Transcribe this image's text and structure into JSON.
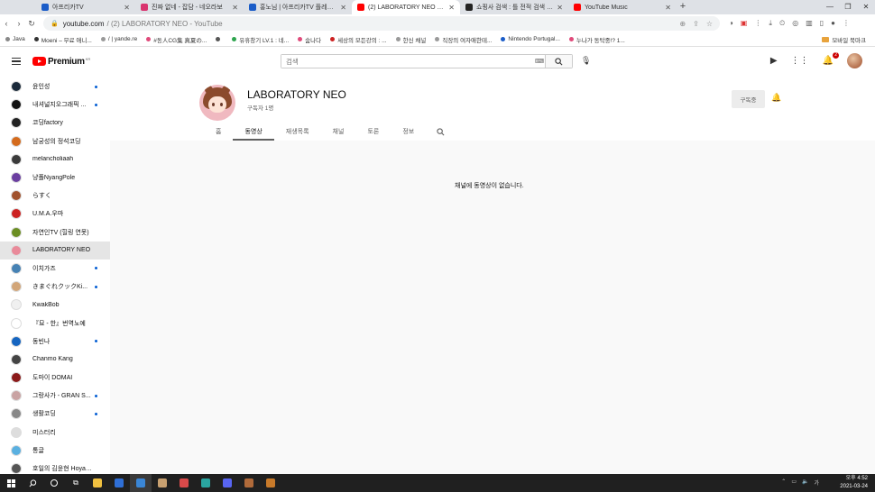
{
  "browser": {
    "tabs": [
      {
        "title": "아프리카TV",
        "color": "#1a5cc8",
        "active": false,
        "width": 110
      },
      {
        "title": "진짜 없네 - 잡담 - 네오라보",
        "color": "#d9346f",
        "active": false,
        "width": 120
      },
      {
        "title": "홍노님 | 아프리카TV 플레이어",
        "color": "#1a5cc8",
        "active": false,
        "width": 120
      },
      {
        "title": "(2) LABORATORY NEO - YouTu",
        "color": "#ff0000",
        "active": true,
        "width": 120
      },
      {
        "title": "쇼핑사 검색 : 틀 전적 검색 포!",
        "color": "#222222",
        "active": false,
        "width": 120
      },
      {
        "title": "YouTube Music",
        "color": "#ff0000",
        "active": false,
        "width": 120
      }
    ],
    "new_tab": "+",
    "window_controls": [
      "—",
      "❐",
      "✕"
    ],
    "url_host": "youtube.com",
    "url_rest": "/ (2) LABORATORY NEO - YouTube",
    "bookmarks": [
      {
        "label": "Java",
        "color": "#888888"
      },
      {
        "label": "Moeni – 무료 애니...",
        "color": "#333333"
      },
      {
        "label": "/ | yande.re",
        "color": "#999999"
      },
      {
        "label": "#동人CG集 真夏の...",
        "color": "#e04a7a"
      },
      {
        "label": "",
        "color": "#555555"
      },
      {
        "label": "유휴창기 LV.1 : 네...",
        "color": "#2da44e"
      },
      {
        "label": "숨나다",
        "color": "#e04a7a"
      },
      {
        "label": "세상의 모든강의 : ...",
        "color": "#cc2222"
      },
      {
        "label": "한신 채널",
        "color": "#999999"
      },
      {
        "label": "직장의 여자애한테...",
        "color": "#999999"
      },
      {
        "label": "Nintendo Portugal...",
        "color": "#1a5cc8"
      },
      {
        "label": "누나가 동탁중!? 1...",
        "color": "#e04a7a"
      }
    ],
    "other_bookmarks": "모바일 북마크"
  },
  "youtube": {
    "logo_text": "Premium",
    "logo_suffix": "KR",
    "search_placeholder": "검색",
    "notifications_count": "2",
    "subscriptions": [
      {
        "name": "윤인성",
        "color": "#1b2a3a",
        "live": true
      },
      {
        "name": "내셔널지오그래픽 ...",
        "color": "#111111",
        "live": true
      },
      {
        "name": "코딩factory",
        "color": "#222222",
        "live": false
      },
      {
        "name": "남궁성의 정석코딩",
        "color": "#d46b1d",
        "live": false
      },
      {
        "name": "melancholiaah",
        "color": "#3b3b3b",
        "live": false
      },
      {
        "name": "냥폴NyangPole",
        "color": "#6b3fa0",
        "live": false
      },
      {
        "name": "らすく",
        "color": "#a0522d",
        "live": false
      },
      {
        "name": "U.M.A.우마",
        "color": "#cc2222",
        "live": false
      },
      {
        "name": "자연인TV (힐링 연못)",
        "color": "#6b8e23",
        "live": false
      },
      {
        "name": "LABORATORY NEO",
        "color": "#e98a9a",
        "live": false,
        "active": true
      },
      {
        "name": "이치가즈",
        "color": "#4682b4",
        "live": true
      },
      {
        "name": "きまぐれクックKi...",
        "color": "#d2a679",
        "live": true
      },
      {
        "name": "KwakBob",
        "color": "#f0f0f0",
        "live": false
      },
      {
        "name": "『묘 - 한』번역노예",
        "color": "#ffffff",
        "live": false
      },
      {
        "name": "동빈나",
        "color": "#1565c0",
        "live": true
      },
      {
        "name": "Chanmo Kang",
        "color": "#444444",
        "live": false
      },
      {
        "name": "도마이 DOMAI",
        "color": "#8b1a1a",
        "live": false
      },
      {
        "name": "그랑사가 - GRAN S...",
        "color": "#c9a3a3",
        "live": true
      },
      {
        "name": "생활코딩",
        "color": "#888888",
        "live": true
      },
      {
        "name": "미스터리",
        "color": "#dddddd",
        "live": false
      },
      {
        "name": "통글",
        "color": "#5ab0e0",
        "live": false
      },
      {
        "name": "호일의 김윤현 Hoyan...",
        "color": "#555555",
        "live": false
      }
    ],
    "channel": {
      "name": "LABORATORY NEO",
      "subscribers": "구독자 1명",
      "subscribe_label": "구독중",
      "tabs": [
        {
          "label": "홈",
          "active": false
        },
        {
          "label": "동영상",
          "active": true
        },
        {
          "label": "재생목록",
          "active": false
        },
        {
          "label": "채널",
          "active": false
        },
        {
          "label": "토론",
          "active": false
        },
        {
          "label": "정보",
          "active": false
        }
      ],
      "empty_message": "채널에 동영상이 없습니다."
    }
  },
  "taskbar": {
    "apps": [
      {
        "name": "file-explorer",
        "color": "#f0c040"
      },
      {
        "name": "store",
        "color": "#2f6fd6"
      },
      {
        "name": "browser-app",
        "color": "#3a86d6",
        "selected": true
      },
      {
        "name": "editor",
        "color": "#c8a070"
      },
      {
        "name": "paint",
        "color": "#d94a4a"
      },
      {
        "name": "edge",
        "color": "#2aa5a0"
      },
      {
        "name": "discord",
        "color": "#5865f2"
      },
      {
        "name": "game",
        "color": "#b06a3a"
      },
      {
        "name": "tool",
        "color": "#c87a2a"
      }
    ],
    "time": "오후 4:52",
    "date": "2021-03-24"
  }
}
